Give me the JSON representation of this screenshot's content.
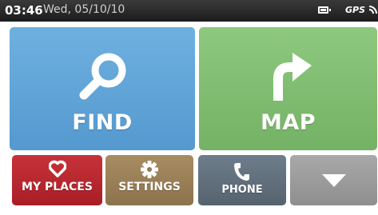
{
  "status_bar": {
    "time": "03:46",
    "date": "Wed, 05/10/10",
    "gps_label": "GPS",
    "icons": [
      "battery-icon",
      "gps-signal-icon"
    ]
  },
  "tiles": {
    "find": {
      "label": "FIND",
      "icon": "magnifier-icon",
      "color": "#5fa4d8"
    },
    "map": {
      "label": "MAP",
      "icon": "turn-right-arrow-icon",
      "color": "#7fbd70"
    },
    "my_places": {
      "label": "MY PLACES",
      "icon": "heart-icon",
      "color": "#b8272e"
    },
    "settings": {
      "label": "SETTINGS",
      "icon": "gear-icon",
      "color": "#9a7f57"
    },
    "phone": {
      "label": "PHONE",
      "icon": "phone-icon",
      "color": "#5f6c78"
    },
    "more": {
      "icon": "chevron-down-icon",
      "color": "#9c9c9c"
    }
  }
}
